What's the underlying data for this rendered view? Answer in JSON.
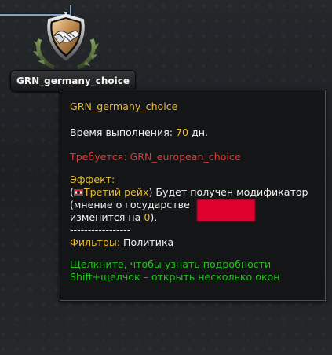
{
  "focus": {
    "name": "GRN_germany_choice",
    "icon": "handshake-shield-icon"
  },
  "tooltip": {
    "title": "GRN_germany_choice",
    "time_prefix": "Время выполнения: ",
    "time_value": "70",
    "time_suffix": " дн.",
    "requires_prefix": "Требуется: ",
    "requires_value": "GRN_european_choice",
    "effect_label": "Эффект:",
    "effect_open_paren": "(",
    "effect_country": "Третий рейх",
    "effect_after_country": ") Будет получен модификатор",
    "effect_line2": "(мнение о государстве",
    "effect_line3_prefix": "изменится на ",
    "effect_value": "0",
    "effect_line3_suffix": ").",
    "separator": "-----------------",
    "filters_label": "Фильтры:",
    "filters_value": " Политика",
    "hint1": "Щелкните, чтобы узнать подробности",
    "hint2": "Shift+щелчок – открыть несколько окон"
  },
  "colors": {
    "gold": "#e7b934",
    "red": "#e53434",
    "green": "#20c31a",
    "tree_line": "#7ea4c9"
  }
}
